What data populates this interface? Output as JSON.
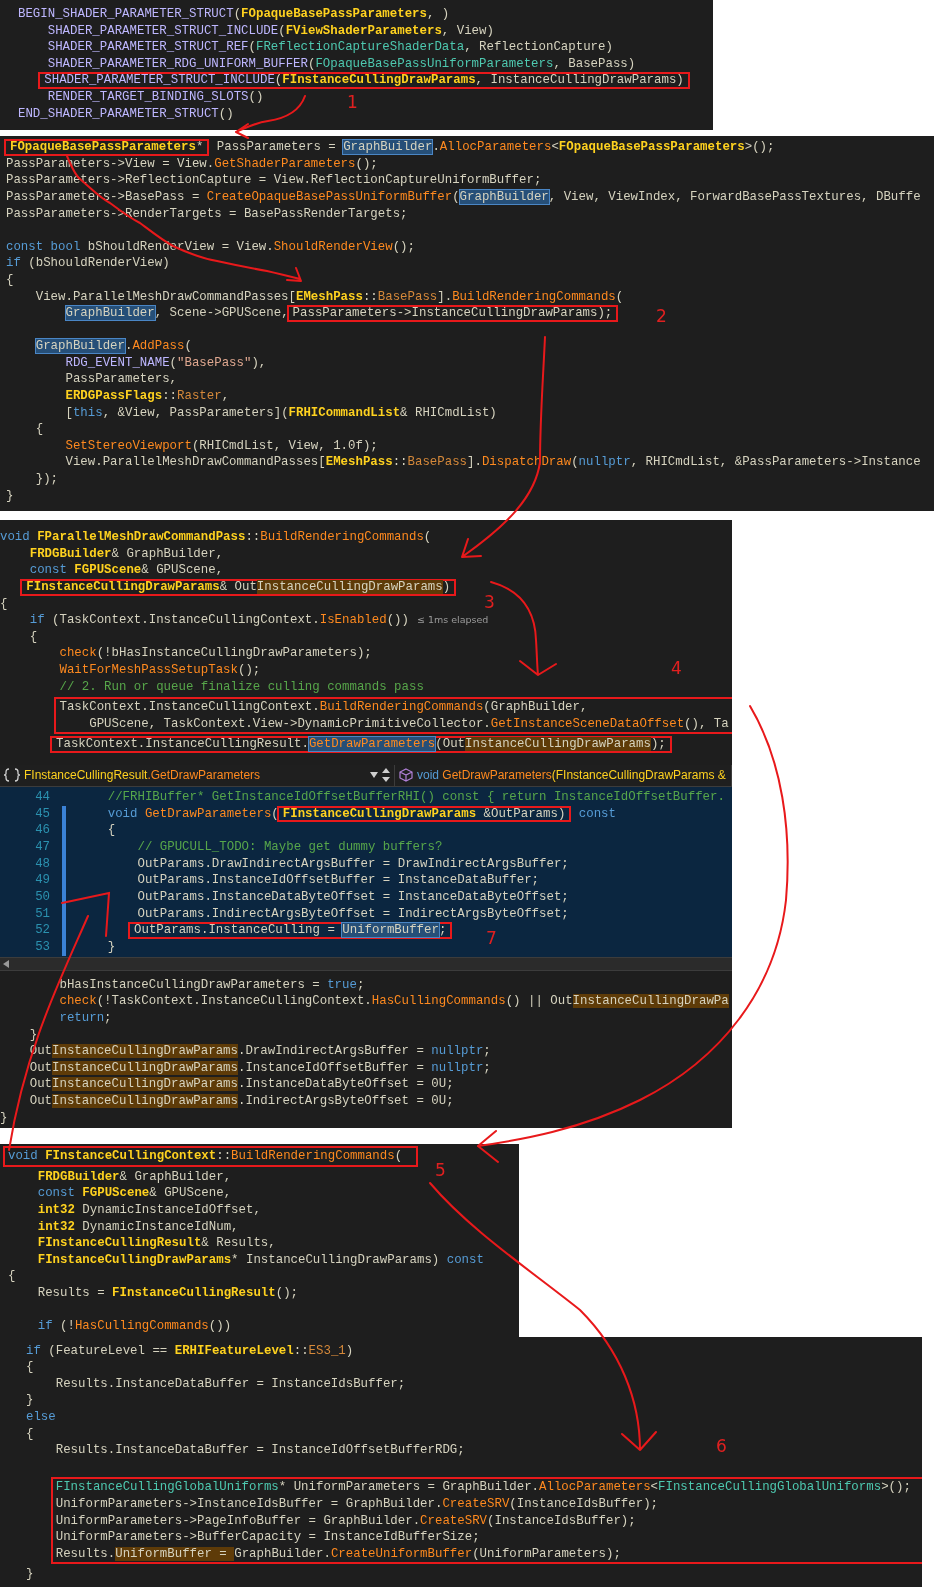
{
  "panels": [
    {
      "kind": "code",
      "lines": [
        {
          "kind": "line",
          "tokens": [
            {
              "kind": "macro",
              "text": "BEGIN_SHADER_PARAMETER_STRUCT"
            },
            {
              "kind": "plain",
              "text": "("
            },
            {
              "kind": "type",
              "text": "FOpaqueBasePassParameters"
            },
            {
              "kind": "plain",
              "text": ", )"
            }
          ]
        },
        {
          "kind": "line",
          "tokens": [
            {
              "kind": "macro",
              "text": "    SHADER_PARAMETER_STRUCT_INCLUDE"
            },
            {
              "kind": "plain",
              "text": "("
            },
            {
              "kind": "type",
              "text": "FViewShaderParameters"
            },
            {
              "kind": "plain",
              "text": ", View)"
            }
          ]
        },
        {
          "kind": "line",
          "tokens": [
            {
              "kind": "macro",
              "text": "    SHADER_PARAMETER_STRUCT_REF"
            },
            {
              "kind": "plain",
              "text": "("
            },
            {
              "kind": "struct",
              "text": "FReflectionCaptureShaderData"
            },
            {
              "kind": "plain",
              "text": ", ReflectionCapture)"
            }
          ]
        },
        {
          "kind": "line",
          "tokens": [
            {
              "kind": "macro",
              "text": "    SHADER_PARAMETER_RDG_UNIFORM_BUFFER"
            },
            {
              "kind": "plain",
              "text": "("
            },
            {
              "kind": "struct",
              "text": "FOpaqueBasePassUniformParameters"
            },
            {
              "kind": "plain",
              "text": ", BasePass)"
            }
          ]
        },
        {
          "kind": "line",
          "tokens": [
            {
              "kind": "box",
              "tokens": [
                {
                  "kind": "macro",
                  "text": "   SHADER_PARAMETER_STRUCT_INCLUDE"
                },
                {
                  "kind": "plain",
                  "text": "("
                },
                {
                  "kind": "type",
                  "text": "FInstanceCullingDrawParams"
                },
                {
                  "kind": "plain",
                  "text": ", InstanceCullingDrawParams)"
                }
              ]
            }
          ]
        },
        {
          "kind": "line",
          "tokens": [
            {
              "kind": "macro",
              "text": "    RENDER_TARGET_BINDING_SLOTS"
            },
            {
              "kind": "plain",
              "text": "()"
            }
          ]
        },
        {
          "kind": "line",
          "tokens": [
            {
              "kind": "macro",
              "text": "END_SHADER_PARAMETER_STRUCT"
            },
            {
              "kind": "plain",
              "text": "()"
            }
          ]
        }
      ]
    },
    {
      "kind": "code",
      "lines": [
        {
          "kind": "line",
          "tokens": [
            {
              "kind": "box",
              "tokens": [
                {
                  "kind": "type",
                  "text": "FOpaqueBasePassParameters"
                },
                {
                  "kind": "plain",
                  "text": "*"
                }
              ]
            },
            {
              "kind": "plain",
              "text": " PassParameters = "
            },
            {
              "kind": "plain",
              "text": "GraphBuilder",
              "referenced": true
            },
            {
              "kind": "plain",
              "text": "."
            },
            {
              "kind": "func",
              "text": "AllocParameters"
            },
            {
              "kind": "plain",
              "text": "<"
            },
            {
              "kind": "type",
              "text": "FOpaqueBasePassParameters"
            },
            {
              "kind": "plain",
              "text": ">();"
            }
          ]
        },
        {
          "kind": "line",
          "tokens": [
            {
              "kind": "plain",
              "text": "PassParameters->View = View."
            },
            {
              "kind": "func",
              "text": "GetShaderParameters"
            },
            {
              "kind": "plain",
              "text": "();"
            }
          ]
        },
        {
          "kind": "line",
          "tokens": [
            {
              "kind": "plain",
              "text": "PassParameters->ReflectionCapture = View.ReflectionCaptureUniformBuffer;"
            }
          ]
        },
        {
          "kind": "line",
          "tokens": [
            {
              "kind": "plain",
              "text": "PassParameters->BasePass = "
            },
            {
              "kind": "func",
              "text": "CreateOpaqueBasePassUniformBuffer"
            },
            {
              "kind": "plain",
              "text": "("
            },
            {
              "kind": "plain",
              "text": "GraphBuilder",
              "referenced": true
            },
            {
              "kind": "plain",
              "text": ", View, ViewIndex, ForwardBasePassTextures, DBuffe"
            }
          ]
        },
        {
          "kind": "line",
          "tokens": [
            {
              "kind": "plain",
              "text": "PassParameters->RenderTargets = BasePassRenderTargets;"
            }
          ]
        },
        {
          "kind": "blank"
        },
        {
          "kind": "line",
          "tokens": [
            {
              "kind": "keyword",
              "text": "const bool"
            },
            {
              "kind": "plain",
              "text": " bShouldRenderView = View."
            },
            {
              "kind": "func",
              "text": "ShouldRenderView"
            },
            {
              "kind": "plain",
              "text": "();"
            }
          ]
        },
        {
          "kind": "line",
          "tokens": [
            {
              "kind": "keyword",
              "text": "if"
            },
            {
              "kind": "plain",
              "text": " (bShouldRenderView)"
            }
          ]
        },
        {
          "kind": "line",
          "tokens": [
            {
              "kind": "plain",
              "text": "{"
            }
          ]
        },
        {
          "kind": "line",
          "tokens": [
            {
              "kind": "plain",
              "text": "    View.ParallelMeshDrawCommandPasses["
            },
            {
              "kind": "type",
              "text": "EMeshPass"
            },
            {
              "kind": "plain",
              "text": "::"
            },
            {
              "kind": "enum",
              "text": "BasePass"
            },
            {
              "kind": "plain",
              "text": "]."
            },
            {
              "kind": "func",
              "text": "BuildRenderingCommands"
            },
            {
              "kind": "plain",
              "text": "("
            }
          ]
        },
        {
          "kind": "line",
          "tokens": [
            {
              "kind": "plain",
              "text": "        GraphBuilder",
              "referenced": true
            },
            {
              "kind": "plain",
              "text": ", Scene->GPUScene,"
            },
            {
              "kind": "box",
              "tokens": [
                {
                  "kind": "plain",
                  "text": "PassParameters->InstanceCullingDrawParams);"
                }
              ]
            }
          ]
        },
        {
          "kind": "blank"
        },
        {
          "kind": "line",
          "tokens": [
            {
              "kind": "plain",
              "text": "    GraphBuilder",
              "referenced": true
            },
            {
              "kind": "plain",
              "text": "."
            },
            {
              "kind": "func",
              "text": "AddPass"
            },
            {
              "kind": "plain",
              "text": "("
            }
          ]
        },
        {
          "kind": "line",
          "tokens": [
            {
              "kind": "macro",
              "text": "        RDG_EVENT_NAME"
            },
            {
              "kind": "plain",
              "text": "("
            },
            {
              "kind": "string",
              "text": "\"BasePass\""
            },
            {
              "kind": "plain",
              "text": "),"
            }
          ]
        },
        {
          "kind": "line",
          "tokens": [
            {
              "kind": "plain",
              "text": "        PassParameters,"
            }
          ]
        },
        {
          "kind": "line",
          "tokens": [
            {
              "kind": "type",
              "text": "        ERDGPassFlags"
            },
            {
              "kind": "plain",
              "text": "::"
            },
            {
              "kind": "enum",
              "text": "Raster"
            },
            {
              "kind": "plain",
              "text": ","
            }
          ]
        },
        {
          "kind": "line",
          "tokens": [
            {
              "kind": "plain",
              "text": "        ["
            },
            {
              "kind": "keyword",
              "text": "this"
            },
            {
              "kind": "plain",
              "text": ", &View, PassParameters]("
            },
            {
              "kind": "type",
              "text": "FRHICommandList"
            },
            {
              "kind": "plain",
              "text": "& RHICmdList)"
            }
          ]
        },
        {
          "kind": "line",
          "tokens": [
            {
              "kind": "plain",
              "text": "    {"
            }
          ]
        },
        {
          "kind": "line",
          "tokens": [
            {
              "kind": "func",
              "text": "        SetStereoViewport"
            },
            {
              "kind": "plain",
              "text": "(RHICmdList, View, 1.0f);"
            }
          ]
        },
        {
          "kind": "line",
          "tokens": [
            {
              "kind": "plain",
              "text": "        View.ParallelMeshDrawCommandPasses["
            },
            {
              "kind": "type",
              "text": "EMeshPass"
            },
            {
              "kind": "plain",
              "text": "::"
            },
            {
              "kind": "enum",
              "text": "BasePass"
            },
            {
              "kind": "plain",
              "text": "]."
            },
            {
              "kind": "func",
              "text": "DispatchDraw"
            },
            {
              "kind": "plain",
              "text": "("
            },
            {
              "kind": "keyword",
              "text": "nullptr"
            },
            {
              "kind": "plain",
              "text": ", RHICmdList, &PassParameters->Instance"
            }
          ]
        },
        {
          "kind": "line",
          "tokens": [
            {
              "kind": "plain",
              "text": "    });"
            }
          ]
        },
        {
          "kind": "line",
          "tokens": [
            {
              "kind": "plain",
              "text": "}"
            }
          ]
        }
      ]
    },
    {
      "kind": "code",
      "lines": [
        {
          "kind": "line",
          "tokens": [
            {
              "kind": "keyword",
              "text": "void "
            },
            {
              "kind": "type",
              "text": "FParallelMeshDrawCommandPass"
            },
            {
              "kind": "plain",
              "text": "::"
            },
            {
              "kind": "func",
              "text": "BuildRenderingCommands"
            },
            {
              "kind": "plain",
              "text": "("
            }
          ]
        },
        {
          "kind": "line",
          "tokens": [
            {
              "kind": "type",
              "text": "    FRDGBuilder"
            },
            {
              "kind": "plain",
              "text": "& GraphBuilder,"
            }
          ]
        },
        {
          "kind": "line",
          "tokens": [
            {
              "kind": "keyword",
              "text": "    const "
            },
            {
              "kind": "type",
              "text": "FGPUScene"
            },
            {
              "kind": "plain",
              "text": "& GPUScene,"
            }
          ]
        },
        {
          "kind": "line",
          "tokens": [
            {
              "kind": "box",
              "tokens": [
                {
                  "kind": "type",
                  "text": "   FInstanceCullingDrawParams"
                },
                {
                  "kind": "plain",
                  "text": "& Out"
                },
                {
                  "kind": "plain",
                  "text": "InstanceCullingDrawParams",
                  "matched": true
                },
                {
                  "kind": "plain",
                  "text": ")"
                }
              ]
            }
          ]
        },
        {
          "kind": "line",
          "tokens": [
            {
              "kind": "plain",
              "text": "{"
            }
          ]
        },
        {
          "kind": "line",
          "tokens": [
            {
              "kind": "keyword",
              "text": "    if"
            },
            {
              "kind": "plain",
              "text": " (TaskContext.InstanceCullingContext."
            },
            {
              "kind": "func",
              "text": "IsEnabled"
            },
            {
              "kind": "plain",
              "text": "())"
            },
            {
              "kind": "hint",
              "text": "≤ 1ms elapsed"
            }
          ]
        },
        {
          "kind": "line",
          "tokens": [
            {
              "kind": "plain",
              "text": "    {"
            }
          ]
        },
        {
          "kind": "line",
          "tokens": [
            {
              "kind": "func",
              "text": "        check"
            },
            {
              "kind": "plain",
              "text": "(!bHasInstanceCullingDrawParameters);"
            }
          ]
        },
        {
          "kind": "line",
          "tokens": [
            {
              "kind": "func",
              "text": "        WaitForMeshPassSetupTask"
            },
            {
              "kind": "plain",
              "text": "();"
            }
          ]
        },
        {
          "kind": "line",
          "tokens": [
            {
              "kind": "comment",
              "text": "        // 2. Run or queue finalize culling commands pass"
            }
          ]
        },
        {
          "kind": "box",
          "lines": [
            {
              "kind": "line",
              "tokens": [
                {
                  "kind": "plain",
                  "text": "        TaskContext.InstanceCullingContext."
                },
                {
                  "kind": "func",
                  "text": "BuildRenderingCommands"
                },
                {
                  "kind": "plain",
                  "text": "(GraphBuilder,"
                }
              ]
            },
            {
              "kind": "line",
              "tokens": [
                {
                  "kind": "plain",
                  "text": "            GPUScene, TaskContext.View->DynamicPrimitiveCollector."
                },
                {
                  "kind": "func",
                  "text": "GetInstanceSceneDataOffset"
                },
                {
                  "kind": "plain",
                  "text": "(), Ta"
                }
              ]
            }
          ]
        },
        {
          "kind": "line",
          "tokens": [
            {
              "kind": "box",
              "tokens": [
                {
                  "kind": "plain",
                  "text": "       TaskContext.InstanceCullingResult."
                },
                {
                  "kind": "func",
                  "text": "GetDrawParameters",
                  "referenced": true
                },
                {
                  "kind": "plain",
                  "text": "(Out"
                },
                {
                  "kind": "plain",
                  "text": "InstanceCullingDrawParams",
                  "matched": true
                },
                {
                  "kind": "plain",
                  "text": ");"
                }
              ]
            }
          ]
        }
      ]
    },
    {
      "kind": "editor",
      "nav": {
        "scope": [
          {
            "kind": "type",
            "text": "FInstanceCullingResult"
          },
          {
            "kind": "func",
            "text": ".GetDrawParameters"
          }
        ],
        "member": [
          {
            "kind": "keyword",
            "text": "void"
          },
          {
            "kind": "func",
            "text": " GetDrawParameters"
          },
          {
            "kind": "type",
            "text": "(FInstanceCullingDrawParams &"
          }
        ]
      },
      "numbered_lines": [
        {
          "number": "44",
          "modified": false,
          "tokens": [
            {
              "kind": "comment",
              "text": "    //FRHIBuffer* GetInstanceIdOffsetBufferRHI() const { return InstanceIdOffsetBuffer."
            }
          ]
        },
        {
          "number": "45",
          "modified": true,
          "tokens": [
            {
              "kind": "keyword",
              "text": "    void "
            },
            {
              "kind": "func",
              "text": "GetDrawParameters"
            },
            {
              "kind": "plain",
              "text": "("
            },
            {
              "kind": "box",
              "tokens": [
                {
                  "kind": "type",
                  "text": "FInstanceCullingDrawParams"
                },
                {
                  "kind": "plain",
                  "text": " &OutParams)"
                }
              ]
            },
            {
              "kind": "keyword",
              "text": " const"
            }
          ]
        },
        {
          "number": "46",
          "modified": true,
          "tokens": [
            {
              "kind": "plain",
              "text": "    {"
            }
          ]
        },
        {
          "number": "47",
          "modified": true,
          "tokens": [
            {
              "kind": "comment",
              "text": "        // GPUCULL_TODO: Maybe get dummy buffers?"
            }
          ]
        },
        {
          "number": "48",
          "modified": true,
          "tokens": [
            {
              "kind": "plain",
              "text": "        OutParams.DrawIndirectArgsBuffer = DrawIndirectArgsBuffer;"
            }
          ]
        },
        {
          "number": "49",
          "modified": true,
          "tokens": [
            {
              "kind": "plain",
              "text": "        OutParams.InstanceIdOffsetBuffer = InstanceDataBuffer;"
            }
          ]
        },
        {
          "number": "50",
          "modified": true,
          "tokens": [
            {
              "kind": "plain",
              "text": "        OutParams.InstanceDataByteOffset = InstanceDataByteOffset;"
            }
          ]
        },
        {
          "number": "51",
          "modified": true,
          "tokens": [
            {
              "kind": "plain",
              "text": "        OutParams.IndirectArgsByteOffset = IndirectArgsByteOffset;"
            }
          ]
        },
        {
          "number": "52",
          "modified": true,
          "tokens": [
            {
              "kind": "box",
              "tokens": [
                {
                  "kind": "plain",
                  "text": "       OutParams.InstanceCulling = "
                },
                {
                  "kind": "plain",
                  "text": "UniformBuffer",
                  "referenced": true
                },
                {
                  "kind": "plain",
                  "text": ";"
                }
              ]
            }
          ]
        },
        {
          "number": "53",
          "modified": true,
          "tokens": [
            {
              "kind": "plain",
              "text": "    }"
            }
          ]
        }
      ],
      "lines": [
        {
          "kind": "line",
          "tokens": [
            {
              "kind": "plain",
              "text": "        bHasInstanceCullingDrawParameters = "
            },
            {
              "kind": "keyword",
              "text": "true"
            },
            {
              "kind": "plain",
              "text": ";"
            }
          ]
        },
        {
          "kind": "line",
          "tokens": [
            {
              "kind": "func",
              "text": "        check"
            },
            {
              "kind": "plain",
              "text": "(!TaskContext.InstanceCullingContext."
            },
            {
              "kind": "func",
              "text": "HasCullingCommands"
            },
            {
              "kind": "plain",
              "text": "() || Out"
            },
            {
              "kind": "plain",
              "text": "InstanceCullingDrawPa",
              "matched": true
            }
          ]
        },
        {
          "kind": "line",
          "tokens": [
            {
              "kind": "keyword",
              "text": "        return"
            },
            {
              "kind": "plain",
              "text": ";"
            }
          ]
        },
        {
          "kind": "line",
          "tokens": [
            {
              "kind": "plain",
              "text": "    }"
            }
          ]
        },
        {
          "kind": "line",
          "tokens": [
            {
              "kind": "plain",
              "text": "    Out"
            },
            {
              "kind": "plain",
              "text": "InstanceCullingDrawParams",
              "matched": true
            },
            {
              "kind": "plain",
              "text": ".DrawIndirectArgsBuffer = "
            },
            {
              "kind": "keyword",
              "text": "nullptr"
            },
            {
              "kind": "plain",
              "text": ";"
            }
          ]
        },
        {
          "kind": "line",
          "tokens": [
            {
              "kind": "plain",
              "text": "    Out"
            },
            {
              "kind": "plain",
              "text": "InstanceCullingDrawParams",
              "matched": true
            },
            {
              "kind": "plain",
              "text": ".InstanceIdOffsetBuffer = "
            },
            {
              "kind": "keyword",
              "text": "nullptr"
            },
            {
              "kind": "plain",
              "text": ";"
            }
          ]
        },
        {
          "kind": "line",
          "tokens": [
            {
              "kind": "plain",
              "text": "    Out"
            },
            {
              "kind": "plain",
              "text": "InstanceCullingDrawParams",
              "matched": true
            },
            {
              "kind": "plain",
              "text": ".InstanceDataByteOffset = 0U;"
            }
          ]
        },
        {
          "kind": "line",
          "tokens": [
            {
              "kind": "plain",
              "text": "    Out"
            },
            {
              "kind": "plain",
              "text": "InstanceCullingDrawParams",
              "matched": true
            },
            {
              "kind": "plain",
              "text": ".IndirectArgsByteOffset = 0U;"
            }
          ]
        },
        {
          "kind": "line",
          "tokens": [
            {
              "kind": "plain",
              "text": "}"
            }
          ]
        }
      ]
    },
    {
      "kind": "code",
      "lines": [
        {
          "kind": "box",
          "lines": [
            {
              "kind": "line",
              "tokens": [
                {
                  "kind": "keyword",
                  "text": "void "
                },
                {
                  "kind": "type",
                  "text": "FInstanceCullingContext"
                },
                {
                  "kind": "plain",
                  "text": "::"
                },
                {
                  "kind": "func",
                  "text": "BuildRenderingCommands"
                },
                {
                  "kind": "plain",
                  "text": "("
                }
              ]
            }
          ]
        },
        {
          "kind": "line",
          "tokens": [
            {
              "kind": "type",
              "text": "    FRDGBuilder"
            },
            {
              "kind": "plain",
              "text": "& GraphBuilder,"
            }
          ]
        },
        {
          "kind": "line",
          "tokens": [
            {
              "kind": "keyword",
              "text": "    const "
            },
            {
              "kind": "type",
              "text": "FGPUScene"
            },
            {
              "kind": "plain",
              "text": "& GPUScene,"
            }
          ]
        },
        {
          "kind": "line",
          "tokens": [
            {
              "kind": "type",
              "text": "    int32"
            },
            {
              "kind": "plain",
              "text": " DynamicInstanceIdOffset,"
            }
          ]
        },
        {
          "kind": "line",
          "tokens": [
            {
              "kind": "type",
              "text": "    int32"
            },
            {
              "kind": "plain",
              "text": " DynamicInstanceIdNum,"
            }
          ]
        },
        {
          "kind": "line",
          "tokens": [
            {
              "kind": "type",
              "text": "    FInstanceCullingResult"
            },
            {
              "kind": "plain",
              "text": "& Results,"
            }
          ]
        },
        {
          "kind": "line",
          "tokens": [
            {
              "kind": "type",
              "text": "    FInstanceCullingDrawParams"
            },
            {
              "kind": "plain",
              "text": "* InstanceCullingDrawParams) "
            },
            {
              "kind": "keyword",
              "text": "const"
            }
          ]
        },
        {
          "kind": "line",
          "tokens": [
            {
              "kind": "plain",
              "text": "{"
            }
          ]
        },
        {
          "kind": "line",
          "tokens": [
            {
              "kind": "plain",
              "text": "    Results = "
            },
            {
              "kind": "type",
              "text": "FInstanceCullingResult"
            },
            {
              "kind": "plain",
              "text": "();"
            }
          ]
        },
        {
          "kind": "blank"
        },
        {
          "kind": "line",
          "tokens": [
            {
              "kind": "keyword",
              "text": "    if"
            },
            {
              "kind": "plain",
              "text": " (!"
            },
            {
              "kind": "func",
              "text": "HasCullingCommands"
            },
            {
              "kind": "plain",
              "text": "())"
            }
          ]
        }
      ]
    },
    {
      "kind": "code",
      "lines": [
        {
          "kind": "line",
          "tokens": [
            {
              "kind": "keyword",
              "text": "if"
            },
            {
              "kind": "plain",
              "text": " (FeatureLevel == "
            },
            {
              "kind": "type",
              "text": "ERHIFeatureLevel"
            },
            {
              "kind": "plain",
              "text": "::"
            },
            {
              "kind": "enum",
              "text": "ES3_1"
            },
            {
              "kind": "plain",
              "text": ")"
            }
          ]
        },
        {
          "kind": "line",
          "tokens": [
            {
              "kind": "plain",
              "text": "{"
            }
          ]
        },
        {
          "kind": "line",
          "tokens": [
            {
              "kind": "plain",
              "text": "    Results.InstanceDataBuffer = InstanceIdsBuffer;"
            }
          ]
        },
        {
          "kind": "line",
          "tokens": [
            {
              "kind": "plain",
              "text": "}"
            }
          ]
        },
        {
          "kind": "line",
          "tokens": [
            {
              "kind": "keyword",
              "text": "else"
            }
          ]
        },
        {
          "kind": "line",
          "tokens": [
            {
              "kind": "plain",
              "text": "{"
            }
          ]
        },
        {
          "kind": "line",
          "tokens": [
            {
              "kind": "plain",
              "text": "    Results.InstanceDataBuffer = InstanceIdOffsetBufferRDG;"
            }
          ]
        },
        {
          "kind": "blank"
        },
        {
          "kind": "box",
          "lines": [
            {
              "kind": "line",
              "tokens": [
                {
                  "kind": "struct",
                  "text": "    FInstanceCullingGlobalUniforms"
                },
                {
                  "kind": "plain",
                  "text": "* UniformParameters = GraphBuilder."
                },
                {
                  "kind": "func",
                  "text": "AllocParameters"
                },
                {
                  "kind": "plain",
                  "text": "<"
                },
                {
                  "kind": "struct",
                  "text": "FInstanceCullingGlobalUniforms"
                },
                {
                  "kind": "plain",
                  "text": ">();"
                }
              ]
            },
            {
              "kind": "line",
              "tokens": [
                {
                  "kind": "plain",
                  "text": "    UniformParameters->InstanceIdsBuffer = GraphBuilder."
                },
                {
                  "kind": "func",
                  "text": "CreateSRV"
                },
                {
                  "kind": "plain",
                  "text": "(InstanceIdsBuffer);"
                }
              ]
            },
            {
              "kind": "line",
              "tokens": [
                {
                  "kind": "plain",
                  "text": "    UniformParameters->PageInfoBuffer = GraphBuilder."
                },
                {
                  "kind": "func",
                  "text": "CreateSRV"
                },
                {
                  "kind": "plain",
                  "text": "(InstanceIdsBuffer);"
                }
              ]
            },
            {
              "kind": "line",
              "tokens": [
                {
                  "kind": "plain",
                  "text": "    UniformParameters->BufferCapacity = InstanceIdBufferSize;"
                }
              ]
            },
            {
              "kind": "line",
              "tokens": [
                {
                  "kind": "plain",
                  "text": "    Results."
                },
                {
                  "kind": "plain",
                  "text": "UniformBuffer = ",
                  "matched": true
                },
                {
                  "kind": "plain",
                  "text": "GraphBuilder."
                },
                {
                  "kind": "func",
                  "text": "CreateUniformBuffer"
                },
                {
                  "kind": "plain",
                  "text": "(UniformParameters);"
                }
              ]
            }
          ]
        },
        {
          "kind": "line",
          "tokens": [
            {
              "kind": "plain",
              "text": "}"
            }
          ]
        }
      ]
    }
  ],
  "annotations": [
    {
      "text": "1"
    },
    {
      "text": "2"
    },
    {
      "text": "3"
    },
    {
      "text": "4"
    },
    {
      "text": "5"
    },
    {
      "text": "6"
    },
    {
      "text": "7"
    }
  ]
}
